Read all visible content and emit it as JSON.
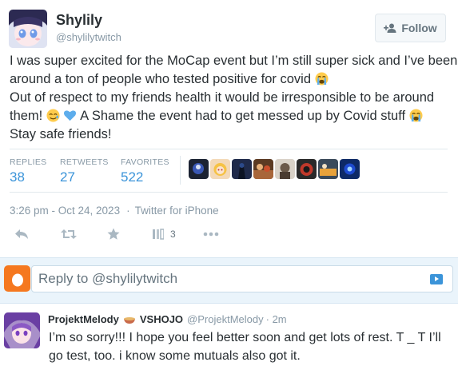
{
  "tweet": {
    "author_name": "Shylily",
    "author_handle": "@shylilytwitch",
    "follow_label": "Follow",
    "text_lines": [
      "I was super excited for the MoCap event but I’m still super sick and I’ve been",
      "around a ton of people who tested positive for covid",
      "Out of respect to my friends health it would be irresponsible to be around",
      "them!",
      "A Shame the event had to get messed up by Covid stuff",
      "Stay safe friends!"
    ],
    "emojis": [
      "crying-face-emoji",
      "smiling-face-with-tear-emoji",
      "blue-heart-emoji",
      "crying-face-emoji"
    ],
    "stats": {
      "replies_label": "REPLIES",
      "replies": "38",
      "retweets_label": "RETWEETS",
      "retweets": "27",
      "favorites_label": "FAVORITES",
      "favorites": "522"
    },
    "timestamp": "3:26 pm - Oct 24, 2023",
    "separator": "·",
    "source": "Twitter for iPhone",
    "views_count": "3"
  },
  "reply_box": {
    "placeholder": "Reply to @shylilytwitch"
  },
  "reply": {
    "author_name": "ProjektMelody",
    "org": "VSHOJO",
    "author_handle": "@ProjektMelody",
    "time": "· 2m",
    "text_lines": [
      "I’m so sorry!!! I hope you feel better soon and get lots of rest. T _ T I’ll",
      "go test, too. i know some mutuals also got it."
    ]
  },
  "colors": {
    "link_blue": "#3b94d9",
    "muted_gray": "#8899a6",
    "reply_bg": "#eaf4fb",
    "egg_orange": "#f5781f"
  },
  "icons": [
    "reply-icon",
    "retweet-icon",
    "favorite-icon",
    "views-icon",
    "more-icon",
    "follow-user-icon",
    "photo-icon"
  ]
}
